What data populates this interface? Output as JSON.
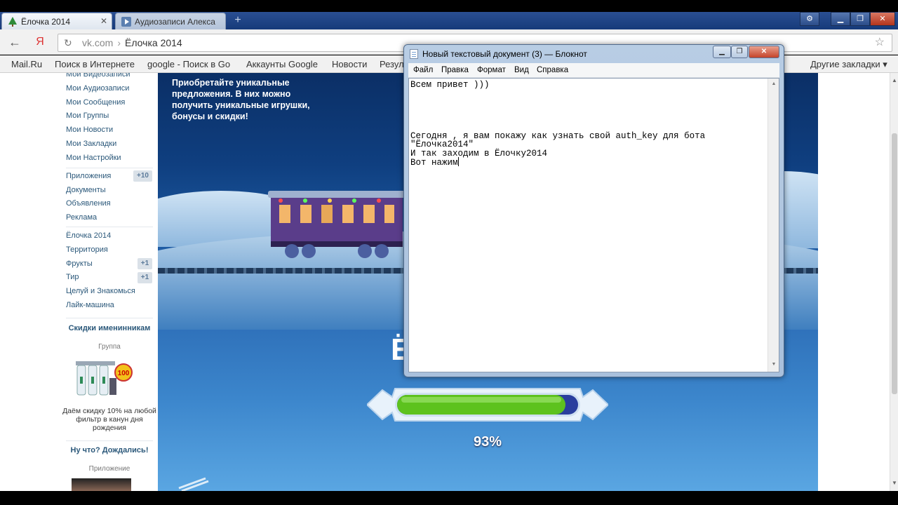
{
  "browser": {
    "tabs": [
      {
        "title": "Ёлочка 2014",
        "active": true
      },
      {
        "title": "Аудиозаписи Алекса",
        "active": false
      }
    ],
    "address": {
      "domain": "vk.com",
      "separator": "›",
      "page": "Ёлочка 2014"
    },
    "bookmarks": [
      "Mail.Ru",
      "Поиск в Интернете",
      "google - Поиск в Go",
      "Аккаунты Google",
      "Новости",
      "Резул",
      "Другие закладки ▾"
    ]
  },
  "sidebar": {
    "items_top": [
      "Мои Видеозаписи",
      "Мои Аудиозаписи",
      "Мои Сообщения",
      "Мои Группы",
      "Мои Новости",
      "Мои Закладки",
      "Мои Настройки"
    ],
    "items_apps": [
      {
        "label": "Приложения",
        "badge": "+10"
      },
      {
        "label": "Документы",
        "badge": ""
      },
      {
        "label": "Объявления",
        "badge": ""
      },
      {
        "label": "Реклама",
        "badge": ""
      }
    ],
    "items_games": [
      {
        "label": "Ёлочка 2014",
        "badge": ""
      },
      {
        "label": "Территория",
        "badge": ""
      },
      {
        "label": "Фрукты",
        "badge": "+1"
      },
      {
        "label": "Тир",
        "badge": "+1"
      },
      {
        "label": "Целуй и Знакомься",
        "badge": ""
      },
      {
        "label": "Лайк-машина",
        "badge": ""
      }
    ],
    "ad1": {
      "title": "Скидки именинникам",
      "subtitle": "Группа",
      "text": "Даём скидку 10% на любой фильтр в канун дня рождения",
      "image_badge": "100"
    },
    "ad2": {
      "title": "Ну что? Дождались!",
      "subtitle": "Приложение"
    }
  },
  "game": {
    "promo": "Приобретайте уникальные предложения. В них можно получить уникальные игрушки, бонусы и скидки!",
    "partial_letter": "Ё",
    "progress": 0.93,
    "progress_label": "93%",
    "colors": {
      "bar_green": "#5dc21e",
      "bar_track": "#2a3f9e",
      "frame": "#e8f2fb"
    }
  },
  "notepad": {
    "title": "Новый текстовый документ (3) — Блокнот",
    "menu": [
      "Файл",
      "Правка",
      "Формат",
      "Вид",
      "Справка"
    ],
    "lines": [
      "Всем привет )))",
      "",
      "",
      "",
      "",
      "Сегодня , я вам покажу как узнать свой auth_key для бота",
      "\"Ёлочка2014\"",
      "И так заходим в Ёлочку2014",
      "Вот нажим"
    ]
  }
}
